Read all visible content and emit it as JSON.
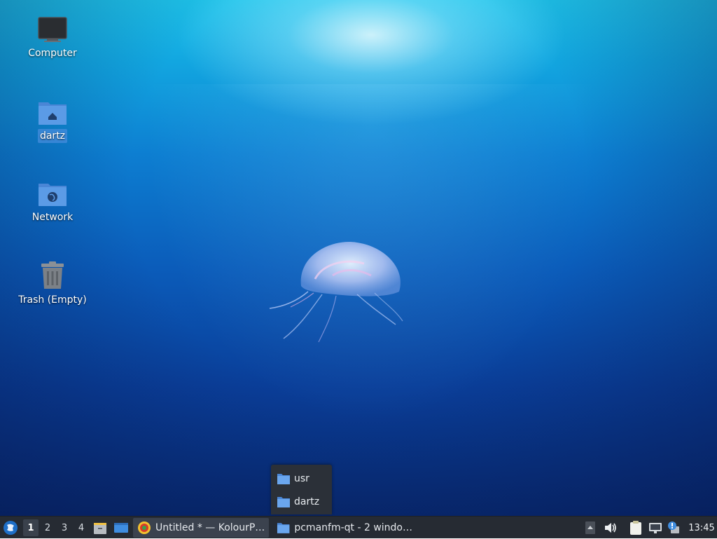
{
  "desktop": {
    "icons": [
      {
        "label": "Computer",
        "icon": "computer-icon"
      },
      {
        "label": "dartz",
        "icon": "home-folder-icon"
      },
      {
        "label": "Network",
        "icon": "network-folder-icon"
      },
      {
        "label": "Trash (Empty)",
        "icon": "trash-icon"
      }
    ]
  },
  "popup": {
    "items": [
      {
        "label": "usr",
        "icon": "folder-icon"
      },
      {
        "label": "dartz",
        "icon": "folder-icon"
      }
    ]
  },
  "taskbar": {
    "menu_icon": "lubuntu-menu-icon",
    "workspaces": [
      "1",
      "2",
      "3",
      "4"
    ],
    "active_workspace": "1",
    "quicklaunch": [
      {
        "icon": "file-manager-icon"
      },
      {
        "icon": "show-desktop-icon"
      }
    ],
    "tasks": [
      {
        "label": "Untitled * — KolourP…",
        "icon": "kolourpaint-icon",
        "active": true
      },
      {
        "label": "pcmanfm-qt - 2 windo…",
        "icon": "folder-icon",
        "active": false
      }
    ],
    "tray": [
      "tray-expand-icon",
      "volume-icon",
      "clipboard-icon",
      "network-icon",
      "update-notifier-icon"
    ],
    "clock": "13:45"
  },
  "colors": {
    "taskbar_bg": "#262b33",
    "popup_bg": "#2b3038",
    "folder_blue": "#5b9be6",
    "selection": "#468cdc"
  }
}
